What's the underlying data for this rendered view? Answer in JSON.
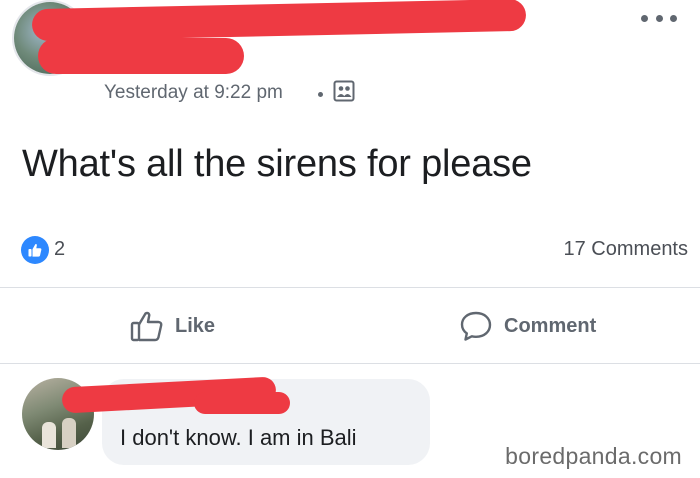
{
  "post": {
    "timestamp": "Yesterday at 9:22 pm",
    "text": "What's all the sirens for please",
    "audience_icon": "friends-icon",
    "more_icon": "more-options-icon"
  },
  "reactions": {
    "icon": "like-reaction-icon",
    "count": "2",
    "comments_count": "17 Comments"
  },
  "actions": {
    "like_label": "Like",
    "comment_label": "Comment"
  },
  "comment": {
    "text": "I don't know. I am in Bali"
  },
  "watermark": "boredpanda.com",
  "colors": {
    "redaction": "#ee3a43",
    "like_blue": "#2d88ff",
    "muted_text": "#606770",
    "bubble_bg": "#f0f2f5"
  }
}
